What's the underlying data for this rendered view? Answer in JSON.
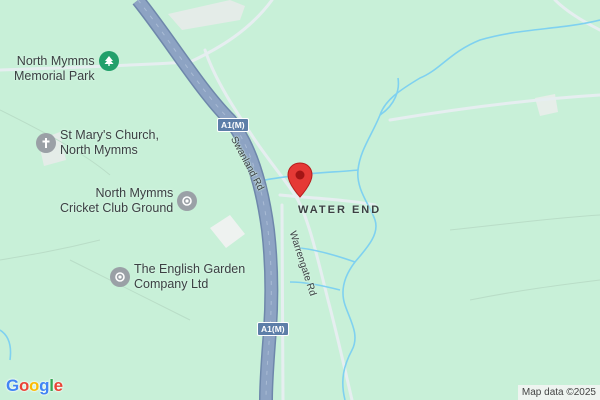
{
  "colors": {
    "land": "#c8f0d8",
    "motorway": "#8da3c3",
    "motorway_edge": "#6e87ab",
    "road": "#e8eef2",
    "water": "#7fd1f0",
    "park_icon": "#22a06b",
    "poi_icon": "#9aa0a6",
    "pin": "#e53935"
  },
  "pois": [
    {
      "id": "memorial-park",
      "lines": [
        "North Mymms",
        "Memorial Park"
      ],
      "icon": "tree-icon"
    },
    {
      "id": "church",
      "lines": [
        "St Mary's Church,",
        "North Mymms"
      ],
      "icon": "cross-icon"
    },
    {
      "id": "cricket",
      "lines": [
        "North Mymms",
        "Cricket Club Ground"
      ],
      "icon": "pin-dot-icon"
    },
    {
      "id": "garden",
      "lines": [
        "The English Garden",
        "Company Ltd"
      ],
      "icon": "pin-dot-icon"
    }
  ],
  "place_label": "WATER END",
  "roads": {
    "swanland": "Swanland Rd",
    "warrengate": "Warrengate Rd",
    "motorway_shield": "A1(M)"
  },
  "logo": {
    "letters": [
      "G",
      "o",
      "o",
      "g",
      "l",
      "e"
    ],
    "colors": [
      "#4285f4",
      "#ea4335",
      "#fbbc05",
      "#4285f4",
      "#34a853",
      "#ea4335"
    ]
  },
  "attribution": "Map data ©2025",
  "marker": "location-pin-icon"
}
